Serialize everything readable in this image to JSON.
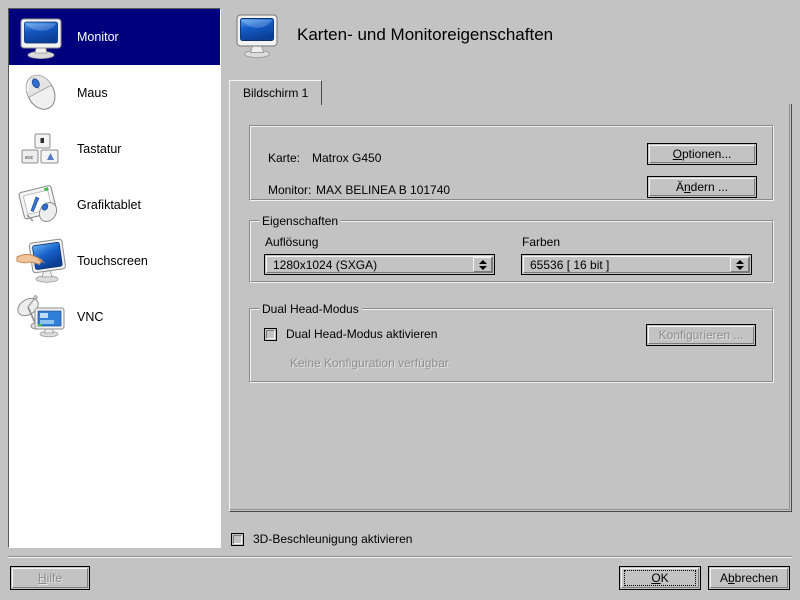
{
  "window": {
    "title": "Karten- und Monitoreigenschaften",
    "title_icon": "monitor-icon"
  },
  "sidebar": {
    "items": [
      {
        "label": "Monitor",
        "icon": "monitor-icon",
        "selected": true
      },
      {
        "label": "Maus",
        "icon": "mouse-icon",
        "selected": false
      },
      {
        "label": "Tastatur",
        "icon": "keyboard-icon",
        "selected": false
      },
      {
        "label": "Grafiktablet",
        "icon": "graphics-tablet-icon",
        "selected": false
      },
      {
        "label": "Touchscreen",
        "icon": "touchscreen-icon",
        "selected": false
      },
      {
        "label": "VNC",
        "icon": "vnc-icon",
        "selected": false
      }
    ]
  },
  "tabs": [
    {
      "label": "Bildschirm 1",
      "active": true
    }
  ],
  "device_box": {
    "card_label": "Karte:",
    "card_value": "Matrox G450",
    "monitor_label": "Monitor:",
    "monitor_value": "MAX BELINEA B 101740",
    "options_button": {
      "label": "Optionen...",
      "accel": "O",
      "enabled": true
    },
    "change_button": {
      "label": "Ändern ...",
      "accel": "n",
      "enabled": true
    }
  },
  "properties_group": {
    "title": "Eigenschaften",
    "resolution": {
      "label": "Auflösung",
      "value": "1280x1024 (SXGA)"
    },
    "colors": {
      "label": "Farben",
      "value": "65536 [ 16 bit ]"
    }
  },
  "dualhead_group": {
    "title": "Dual Head-Modus",
    "enable_checkbox": {
      "label": "Dual Head-Modus aktivieren",
      "checked": false
    },
    "configure_button": {
      "label": "Konfigurieren ...",
      "enabled": false
    },
    "status_text": "Keine Konfiguration verfügbar"
  },
  "accel_3d": {
    "label": "3D-Beschleunigung aktivieren",
    "checked": false
  },
  "footer": {
    "help_button": {
      "label": "Hilfe",
      "accel": "H",
      "enabled": false
    },
    "ok_button": {
      "label": "OK",
      "accel": "O",
      "enabled": true,
      "default": true
    },
    "cancel_button": {
      "label": "Abbrechen",
      "accel": "b",
      "enabled": true
    }
  },
  "colors": {
    "window_bg": "#c3c3c3",
    "selection_bg": "#00007f",
    "selection_fg": "#ffffff",
    "list_bg": "#ffffff",
    "disabled_fg": "#8f8f8f",
    "icon_blue": "#1b5fc8"
  }
}
